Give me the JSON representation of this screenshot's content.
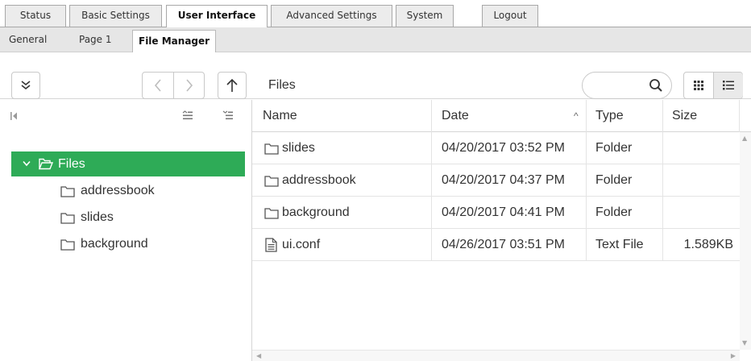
{
  "top_tabs": [
    {
      "label": "Status"
    },
    {
      "label": "Basic Settings"
    },
    {
      "label": "User Interface"
    },
    {
      "label": "Advanced Settings"
    },
    {
      "label": "System"
    },
    {
      "label": "Logout"
    }
  ],
  "sub_tabs": [
    {
      "label": "General"
    },
    {
      "label": "Page 1"
    },
    {
      "label": "File Manager"
    }
  ],
  "toolbar": {
    "breadcrumb": "Files",
    "search_value": ""
  },
  "tree": {
    "root_label": "Files",
    "children": [
      {
        "label": "addressbook"
      },
      {
        "label": "slides"
      },
      {
        "label": "background"
      }
    ]
  },
  "grid": {
    "columns": {
      "name": "Name",
      "date": "Date",
      "type": "Type",
      "size": "Size"
    },
    "sort_indicator": "^",
    "rows": [
      {
        "name": "slides",
        "date": "04/20/2017 03:52 PM",
        "type": "Folder",
        "size": "",
        "icon": "folder-icon"
      },
      {
        "name": "addressbook",
        "date": "04/20/2017 04:37 PM",
        "type": "Folder",
        "size": "",
        "icon": "folder-icon"
      },
      {
        "name": "background",
        "date": "04/20/2017 04:41 PM",
        "type": "Folder",
        "size": "",
        "icon": "folder-icon"
      },
      {
        "name": "ui.conf",
        "date": "04/26/2017 03:51 PM",
        "type": "Text File",
        "size": "1.589KB",
        "icon": "text-file-icon"
      }
    ]
  },
  "colors": {
    "accent": "#2eab57",
    "border": "#a8a8a8",
    "tab_bg": "#ececec",
    "subbar_bg": "#e6e6e6"
  }
}
